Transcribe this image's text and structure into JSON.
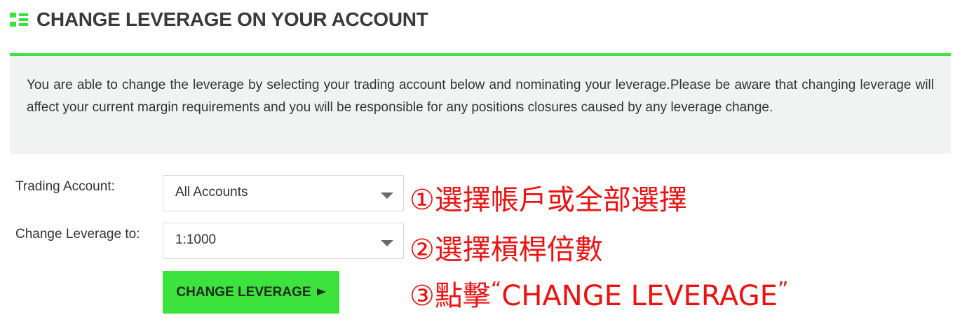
{
  "header": {
    "icon": "list-icon",
    "title": "CHANGE LEVERAGE ON YOUR ACCOUNT"
  },
  "colors": {
    "accent_green": "#3ce33c",
    "notice_bg": "#f1f2f2",
    "annotation_red": "#ee1111"
  },
  "notice": {
    "text": "You are able to change the leverage by selecting your trading account below and nominating your leverage.Please be aware that changing leverage will affect your current margin requirements and you will be responsible for any positions closures caused by any leverage change."
  },
  "form": {
    "account_label": "Trading Account:",
    "account_value": "All Accounts",
    "leverage_label": "Change Leverage to:",
    "leverage_value": "1:1000",
    "submit_label": "CHANGE LEVERAGE"
  },
  "annotations": {
    "step1": "①選擇帳戶或全部選擇",
    "step2": "②選擇槓桿倍數",
    "step3_prefix": "③點擊",
    "step3_open_quote": "“",
    "step3_text": "CHANGE LEVERAGE",
    "step3_close_quote": "”"
  }
}
